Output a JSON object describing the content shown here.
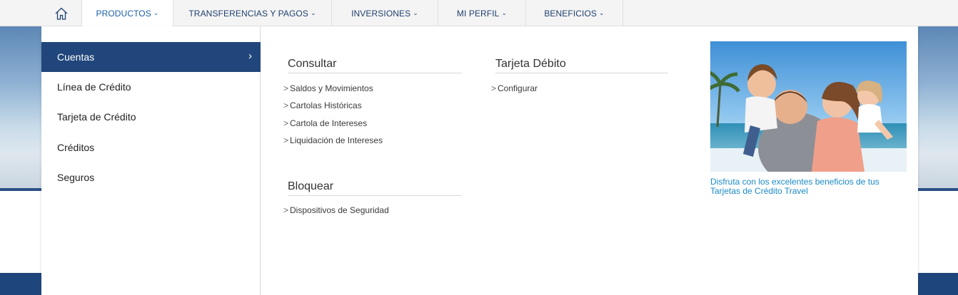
{
  "nav": {
    "home_icon": "home-icon",
    "items": [
      {
        "label": "PRODUCTOS"
      },
      {
        "label": "TRANSFERENCIAS Y PAGOS"
      },
      {
        "label": "INVERSIONES"
      },
      {
        "label": "MI PERFIL"
      },
      {
        "label": "BENEFICIOS"
      }
    ],
    "chevron": "⌄"
  },
  "sidebar": {
    "items": [
      {
        "label": "Cuentas",
        "active": true
      },
      {
        "label": "Línea de Crédito"
      },
      {
        "label": "Tarjeta de Crédito"
      },
      {
        "label": "Créditos"
      },
      {
        "label": "Seguros"
      }
    ],
    "chevron": "›"
  },
  "sections": {
    "consultar": {
      "title": "Consultar",
      "links": [
        "Saldos y Movimientos",
        "Cartolas Históricas",
        "Cartola de Intereses",
        "Liquidación de Intereses"
      ]
    },
    "bloquear": {
      "title": "Bloquear",
      "links": [
        "Dispositivos de Seguridad"
      ]
    },
    "tarjeta_debito": {
      "title": "Tarjeta Débito",
      "links": [
        "Configurar"
      ]
    }
  },
  "link_prefix": ">",
  "promo": {
    "caption": "Disfruta con los excelentes beneficios de tus Tarjetas de Crédito Travel"
  },
  "colors": {
    "accent": "#21467b",
    "link_blue": "#1a8ac6",
    "nav_text": "#21416f"
  }
}
